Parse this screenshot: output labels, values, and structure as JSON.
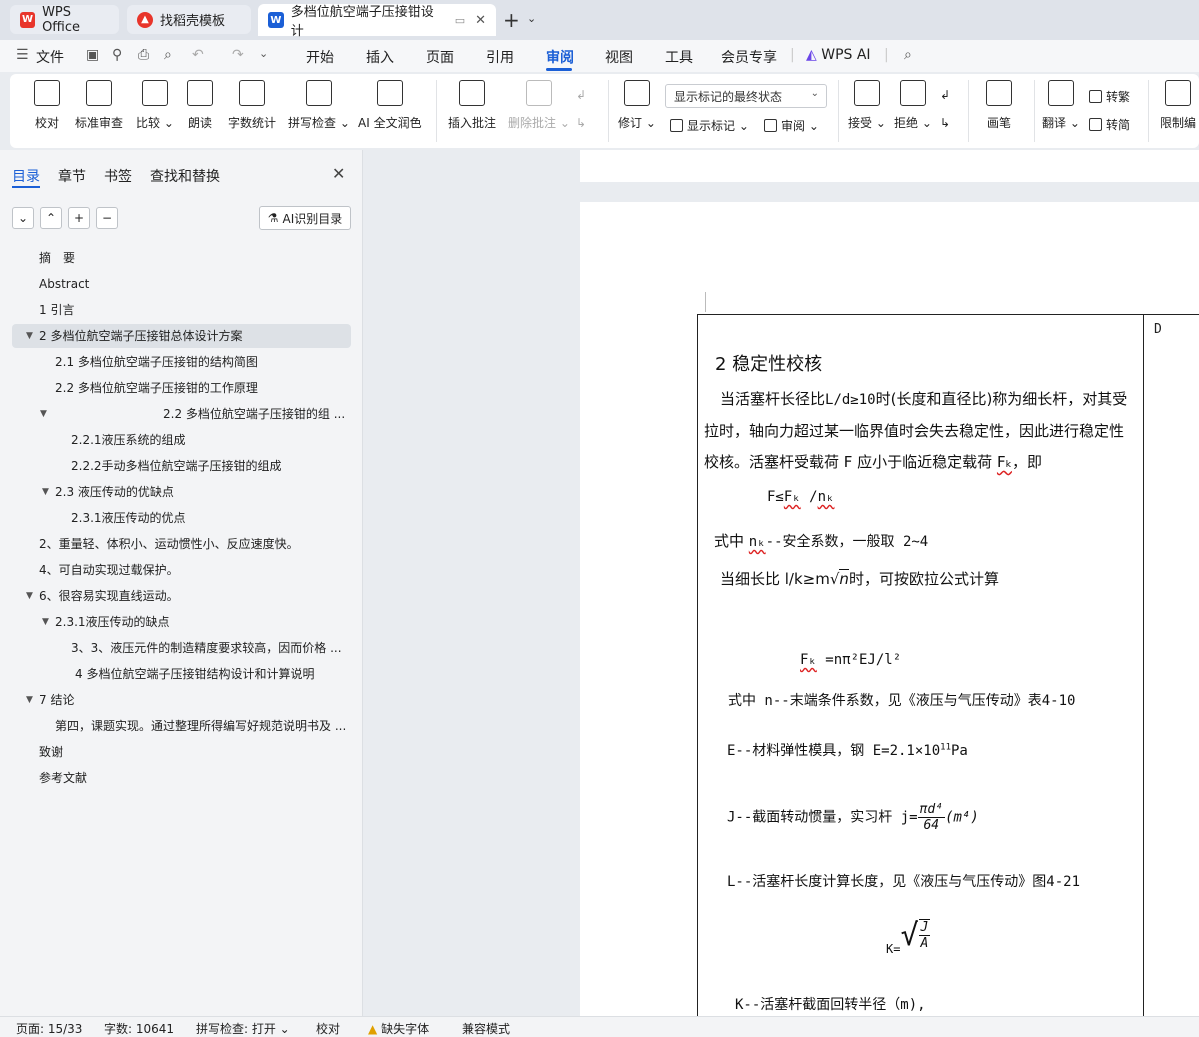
{
  "tabs": [
    {
      "label": "WPS Office",
      "icon": "wps-logo-icon"
    },
    {
      "label": "找稻壳模板",
      "icon": "docer-logo-icon"
    },
    {
      "label": "多档位航空端子压接钳设计",
      "icon": "writer-logo-icon"
    }
  ],
  "tab_logo_letters": {
    "writer": "W"
  },
  "menu": {
    "file": "文件",
    "items": [
      "开始",
      "插入",
      "页面",
      "引用",
      "审阅",
      "视图",
      "工具",
      "会员专享",
      "WPS AI"
    ],
    "active": "审阅"
  },
  "ribbon": {
    "buttons": [
      {
        "label": "校对",
        "icon": "proofread-icon"
      },
      {
        "label": "标准审查",
        "icon": "standard-review-icon"
      },
      {
        "label": "比较",
        "icon": "compare-icon"
      },
      {
        "label": "朗读",
        "icon": "read-aloud-icon"
      },
      {
        "label": "字数统计",
        "icon": "word-count-icon"
      },
      {
        "label": "拼写检查",
        "icon": "spell-check-icon"
      },
      {
        "label": "AI 全文润色",
        "icon": "ai-polish-icon"
      },
      {
        "label": "插入批注",
        "icon": "insert-comment-icon"
      },
      {
        "label": "删除批注",
        "icon": "delete-comment-icon"
      },
      {
        "label": "修订",
        "icon": "track-changes-icon"
      },
      {
        "label": "接受",
        "icon": "accept-icon"
      },
      {
        "label": "拒绝",
        "icon": "reject-icon"
      },
      {
        "label": "画笔",
        "icon": "pen-icon"
      },
      {
        "label": "翻译",
        "icon": "translate-icon"
      },
      {
        "label": "限制编",
        "icon": "restrict-edit-icon"
      }
    ],
    "markup_dropdown": "显示标记的最终状态",
    "show_markup": "显示标记",
    "review": "审阅",
    "to_traditional": "转繁",
    "to_simplified": "转简"
  },
  "nav": {
    "tabs": [
      "目录",
      "章节",
      "书签",
      "查找和替换"
    ],
    "active_tab": "目录",
    "ai_toc_button": "AI识别目录",
    "toc": [
      {
        "text": "摘　要",
        "level": 0
      },
      {
        "text": "Abstract",
        "level": 0
      },
      {
        "text": "1 引言",
        "level": 0
      },
      {
        "text": "2 多档位航空端子压接钳总体设计方案",
        "level": 0,
        "expanded": true,
        "selected": true
      },
      {
        "text": "2.1 多档位航空端子压接钳的结构简图",
        "level": 1
      },
      {
        "text": "2.2 多档位航空端子压接钳的工作原理",
        "level": 1
      },
      {
        "text": "2.2 多档位航空端子压接钳的组 ...",
        "level": 1,
        "expanded": true
      },
      {
        "text": "2.2.1液压系统的组成",
        "level": 2
      },
      {
        "text": "2.2.2手动多档位航空端子压接钳的组成",
        "level": 2
      },
      {
        "text": "2.3 液压传动的优缺点",
        "level": 1,
        "expanded": true
      },
      {
        "text": "2.3.1液压传动的优点",
        "level": 2
      },
      {
        "text": "2、重量轻、体积小、运动惯性小、反应速度快。",
        "level": 0
      },
      {
        "text": "4、可自动实现过载保护。",
        "level": 0
      },
      {
        "text": "6、很容易实现直线运动。",
        "level": 0,
        "expanded": true
      },
      {
        "text": "2.3.1液压传动的缺点",
        "level": 1,
        "expanded": true
      },
      {
        "text": "3、3、液压元件的制造精度要求较高，因而价格 ...",
        "level": 2
      },
      {
        "text": "4 多档位航空端子压接钳结构设计和计算说明",
        "level": 2
      },
      {
        "text": "7 结论",
        "level": 0,
        "expanded": true
      },
      {
        "text": "第四，课题实现。通过整理所得编写好规范说明书及 ...",
        "level": 1
      },
      {
        "text": "致谢",
        "level": 0
      },
      {
        "text": "参考文献",
        "level": 0
      }
    ]
  },
  "document": {
    "frame_letter": "D",
    "heading": "2 稳定性校核",
    "para1_a": "当活塞杆长径比",
    "para1_ratio": "L/d≥10",
    "para1_b": "时(长度和直径比)称为细长杆，对其受拉时，轴向力超过某一临界值时会失去稳定性，因此进行稳定性校核。活塞杆受载荷 F 应小于临近稳定载荷",
    "para1_fk": "Fₖ",
    "para1_end": "，即",
    "formula1_lhs": "F≤",
    "formula1_fk": "Fₖ",
    "formula1_mid": " /",
    "formula1_nk": "nₖ",
    "line_safety_pre": "式中",
    "line_safety_nk": "nₖ",
    "line_safety_post": "--安全系数，一般取 2~4",
    "line_slender_pre": "当细长比 l/k≥m",
    "line_slender_root": "n",
    "line_slender_post": "时，可按欧拉公式计算",
    "formula2_fk": "Fₖ",
    "formula2_rest": " =nπ²EJ/l²",
    "line_n": "式中 n--末端条件系数，见《液压与气压传动》表4-10",
    "line_e_pre": "E--材料弹性模具，钢 E=2.1×10",
    "line_e_exp": "11",
    "line_e_unit": "Pa",
    "line_j_pre": "J--截面转动惯量，实习杆 j=",
    "line_j_num": "πd⁴",
    "line_j_den": "64",
    "line_j_unit": "(m⁴)",
    "line_l": "L--活塞杆长度计算长度，见《液压与气压传动》图4-21",
    "formula3_lhs": "K=",
    "formula3_num": "J",
    "formula3_den": "A",
    "line_k": "K--活塞杆截面回转半径（m),"
  },
  "status": {
    "page": "页面: 15/33",
    "words": "字数: 10641",
    "spell": "拼写检查: 打开",
    "proof": "校对",
    "missing_font": "缺失字体",
    "compat": "兼容模式"
  }
}
